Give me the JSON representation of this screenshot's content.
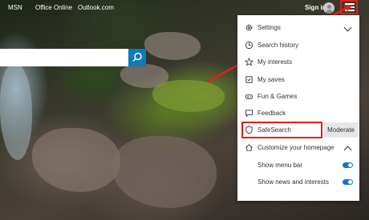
{
  "topnav": {
    "links": [
      "MSN",
      "Office Online",
      "Outlook.com"
    ],
    "sign_in": "Sign in"
  },
  "menu": {
    "items": [
      {
        "label": "Settings",
        "icon": "gear-icon"
      },
      {
        "label": "Search history",
        "icon": "history-icon"
      },
      {
        "label": "My interests",
        "icon": "star-icon"
      },
      {
        "label": "My saves",
        "icon": "saves-icon"
      },
      {
        "label": "Fun & Games",
        "icon": "games-icon"
      },
      {
        "label": "Feedback",
        "icon": "feedback-icon"
      },
      {
        "label": "SafeSearch",
        "icon": "shield-icon"
      },
      {
        "label": "Customize your homepage",
        "icon": "home-icon"
      }
    ],
    "safesearch_value": "Moderate",
    "toggles": [
      {
        "label": "Show menu bar",
        "on": true
      },
      {
        "label": "Show news and interests",
        "on": true
      }
    ]
  },
  "colors": {
    "highlight": "#e0201b",
    "accent": "#1a73c9",
    "search_button": "#0f7ab8"
  }
}
